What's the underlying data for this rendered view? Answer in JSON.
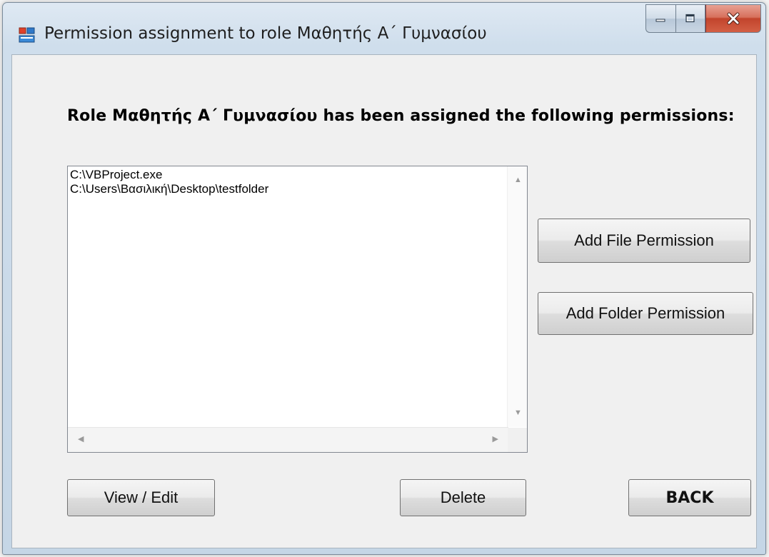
{
  "window": {
    "title": "Permission assignment to role Μαθητής Α΄ Γυμνασίου",
    "controls": [
      "minimize",
      "maximize",
      "close"
    ]
  },
  "heading": "Role Μαθητής Α΄ Γυμνασίου has been assigned the following permissions:",
  "permissions_list": {
    "items": [
      "C:\\VBProject.exe",
      "C:\\Users\\Βασιλική\\Desktop\\testfolder"
    ]
  },
  "buttons": {
    "add_file": "Add File Permission",
    "add_folder": "Add Folder Permission",
    "view_edit": "View / Edit",
    "delete": "Delete",
    "back": "BACK"
  }
}
